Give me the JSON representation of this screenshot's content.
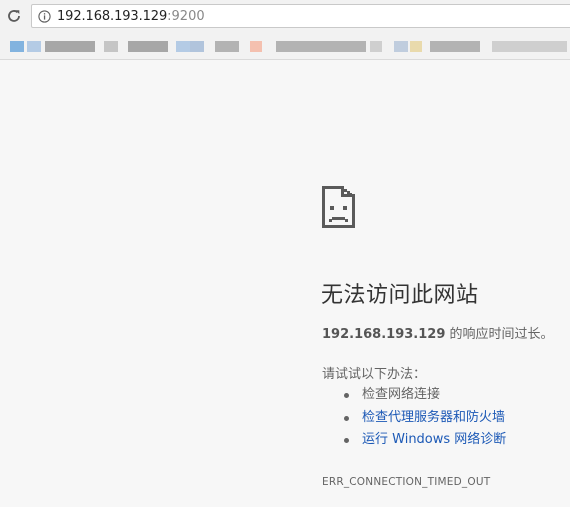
{
  "toolbar": {
    "reload_icon": "reload-icon",
    "info_icon": "info-icon",
    "url_host": "192.168.193.129",
    "url_port": ":9200"
  },
  "bookmarks": {
    "note": "blurred bookmark items",
    "colors": [
      "#6fa8dc",
      "#a9c4e3",
      "#9a9a9a",
      "#bdbdbd",
      "#a6bcd8",
      "#f5b7a3",
      "#a8a8a8",
      "#c9c9c9",
      "#b7c7db",
      "#e7d6a0"
    ]
  },
  "error": {
    "icon": "sad-page-icon",
    "heading": "无法访问此网站",
    "host": "192.168.193.129",
    "summary_rest": " 的响应时间过长。",
    "suggest_title": "请试试以下办法：",
    "suggestions": [
      {
        "label": "检查网络连接",
        "link": false
      },
      {
        "label": "检查代理服务器和防火墙",
        "link": true
      },
      {
        "label": "运行 Windows 网络诊断",
        "link": true
      }
    ],
    "code": "ERR_CONNECTION_TIMED_OUT"
  },
  "colors": {
    "background": "#f7f7f7",
    "heading": "#333333",
    "text": "#646464",
    "link": "#1c59b6"
  }
}
